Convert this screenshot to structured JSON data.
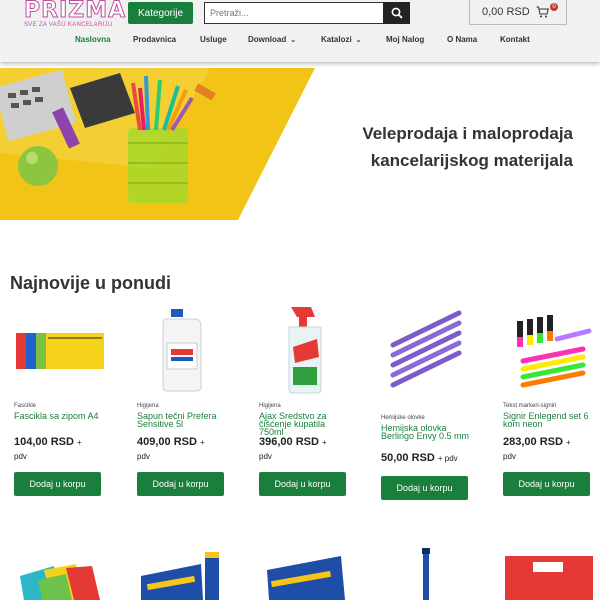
{
  "header": {
    "logo_name": "PRIZMA",
    "logo_tagline": "SVE ZA VAŠU KANCELARIJU",
    "category_button": "Kategorije",
    "search_placeholder": "Pretraži...",
    "cart_total": "0,00 RSD",
    "cart_count": "0"
  },
  "nav": [
    {
      "label": "Naslovna",
      "active": true
    },
    {
      "label": "Prodavnica"
    },
    {
      "label": "Usluge"
    },
    {
      "label": "Download",
      "dropdown": true
    },
    {
      "label": "Katalozi",
      "dropdown": true
    },
    {
      "label": "Moj Nalog"
    },
    {
      "label": "O Nama"
    },
    {
      "label": "Kontakt"
    }
  ],
  "hero": {
    "line1": "Veleprodaja i maloprodaja",
    "line2": "kancelarijskog materijala"
  },
  "section_title": "Najnovije u ponudi",
  "products": [
    {
      "category": "Fascikle",
      "title": "Fascikla sa zipom A4",
      "price": "104,00 RSD",
      "pdv": "pdv",
      "button": "Dodaj u korpu"
    },
    {
      "category": "Higijena",
      "title": "Sapun tečni Prefera Sensitive 5l",
      "price": "409,00 RSD",
      "pdv": "pdv",
      "button": "Dodaj u korpu"
    },
    {
      "category": "Higijena",
      "title": "Ajax Sredstvo za čišćenje kupatila 750ml",
      "price": "396,00 RSD",
      "pdv": "pdv",
      "button": "Dodaj u korpu"
    },
    {
      "category": "Hemijske olovke",
      "title": "Hemijska olovka Berlingo Envy 0.5 mm",
      "price": "50,00 RSD",
      "pdv": "pdv",
      "button": "Dodaj u korpu"
    },
    {
      "category": "Tekst markeri-signiri",
      "title": "Signir Enlegend set 6 kom neon",
      "price": "283,00 RSD",
      "pdv": "pdv",
      "button": "Dodaj u korpu"
    }
  ],
  "colors": {
    "accent": "#1a7f3c",
    "brand": "#c54aa3"
  }
}
